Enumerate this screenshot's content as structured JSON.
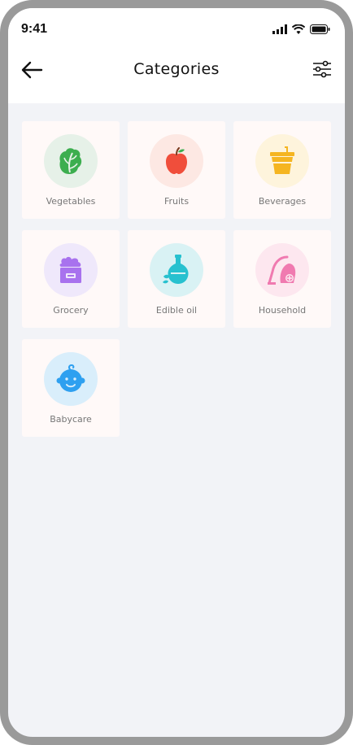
{
  "status": {
    "time": "9:41"
  },
  "header": {
    "title": "Categories"
  },
  "categories": [
    {
      "label": "Vegetables",
      "icon": "lettuce-icon",
      "bg": "#e6f1e8",
      "color": "#3cae4f"
    },
    {
      "label": "Fruits",
      "icon": "apple-icon",
      "bg": "#fde8e3",
      "color": "#f04e3b"
    },
    {
      "label": "Beverages",
      "icon": "cup-icon",
      "bg": "#fef4dc",
      "color": "#f5b521"
    },
    {
      "label": "Grocery",
      "icon": "grocery-bag-icon",
      "bg": "#efe8fb",
      "color": "#a872ee"
    },
    {
      "label": "Edible oil",
      "icon": "oil-bottle-icon",
      "bg": "#d9f2f4",
      "color": "#27c1cf"
    },
    {
      "label": "Household",
      "icon": "vacuum-cleaner-icon",
      "bg": "#fde7ef",
      "color": "#f07ab0"
    },
    {
      "label": "Babycare",
      "icon": "baby-face-icon",
      "bg": "#d9eefb",
      "color": "#2ea0f0"
    }
  ]
}
